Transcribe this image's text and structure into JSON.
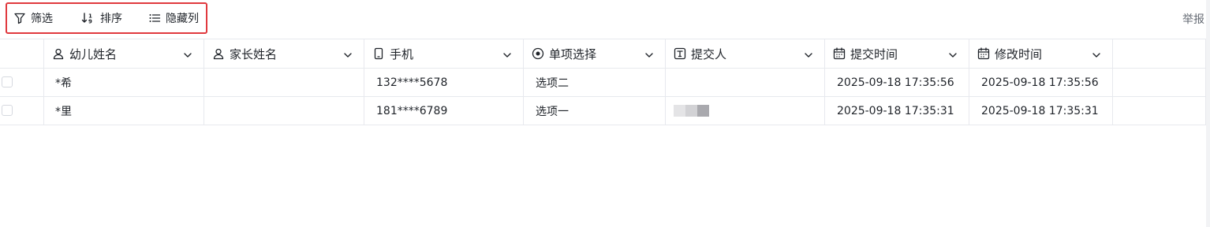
{
  "toolbar": {
    "filter_label": "筛选",
    "sort_label": "排序",
    "hide_columns_label": "隐藏列"
  },
  "report_label": "举报",
  "table": {
    "columns": [
      {
        "label": "幼儿姓名",
        "icon": "person-icon"
      },
      {
        "label": "家长姓名",
        "icon": "person-icon"
      },
      {
        "label": "手机",
        "icon": "phone-icon"
      },
      {
        "label": "单项选择",
        "icon": "radio-icon"
      },
      {
        "label": "提交人",
        "icon": "text-field-icon"
      },
      {
        "label": "提交时间",
        "icon": "calendar-icon"
      },
      {
        "label": "修改时间",
        "icon": "calendar-icon"
      }
    ],
    "rows": [
      {
        "child_name": "*希",
        "parent_name": "",
        "phone": "132****5678",
        "choice": "选项二",
        "submitter": "",
        "submit_time": "2025-09-18 17:35:56",
        "modify_time": "2025-09-18 17:35:56"
      },
      {
        "child_name": "*里",
        "parent_name": "",
        "phone": "181****6789",
        "choice": "选项一",
        "submitter": "",
        "submit_time": "2025-09-18 17:35:31",
        "modify_time": "2025-09-18 17:35:31"
      }
    ]
  },
  "colors": {
    "highlight_border": "#e0393e",
    "grid_line": "#e7e9ee",
    "muted_text": "#646a73",
    "blur_pixels": [
      "#e4e4e6",
      "#d2d2d5",
      "#a9a9ae"
    ]
  }
}
